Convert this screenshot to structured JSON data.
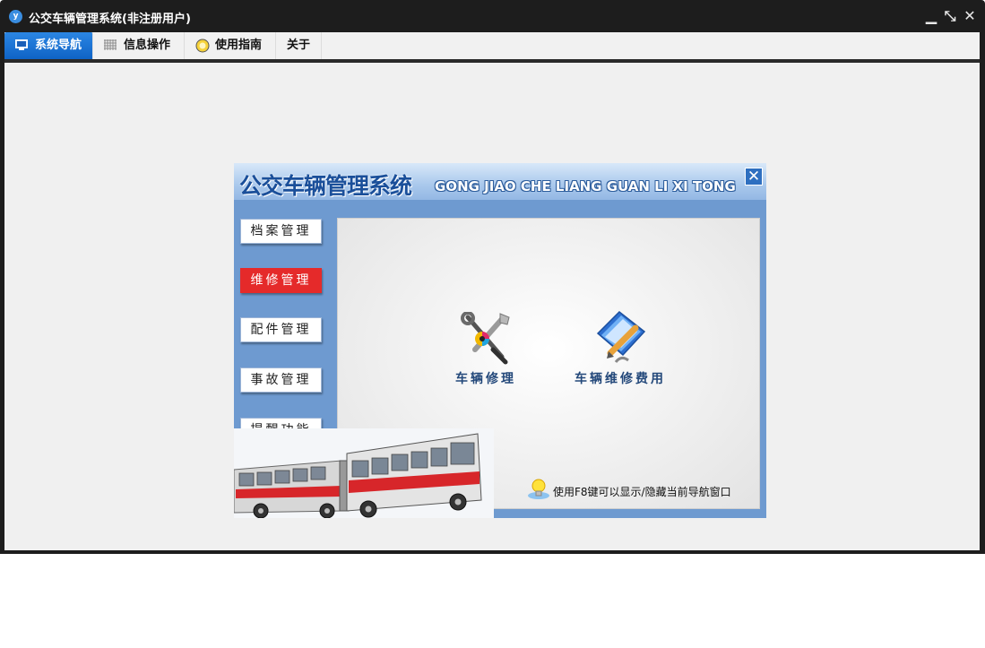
{
  "window": {
    "app_icon_text": "y",
    "title": "公交车辆管理系统(非注册用户)",
    "controls": {
      "minimize": "▁",
      "restore": "⤡",
      "close": "✕"
    }
  },
  "menu": {
    "tabs": [
      {
        "label": "系统导航",
        "icon": "monitor-icon",
        "active": true
      },
      {
        "label": "信息操作",
        "icon": "grid-icon",
        "active": false
      },
      {
        "label": "使用指南",
        "icon": "help-icon",
        "active": false
      },
      {
        "label": "关于",
        "icon": "",
        "active": false
      }
    ]
  },
  "panel": {
    "title": "公交车辆管理系统",
    "subtitle": "GONG JIAO CHE LIANG GUAN LI XI TONG",
    "close": "✕",
    "sidebar": [
      {
        "label": "档案管理",
        "active": false
      },
      {
        "label": "维修管理",
        "active": true
      },
      {
        "label": "配件管理",
        "active": false
      },
      {
        "label": "事故管理",
        "active": false
      },
      {
        "label": "提醒功能",
        "active": false
      }
    ],
    "features": [
      {
        "label": "车辆修理",
        "icon": "wrench-screwdriver-icon"
      },
      {
        "label": "车辆维修费用",
        "icon": "document-pencil-icon"
      }
    ],
    "hint": "使用F8键可以显示/隐藏当前导航窗口"
  },
  "colors": {
    "accent": "#0f63c6",
    "active_side": "#e52a2a",
    "title_blue": "#1a4f9a",
    "panel_blue": "#6e9ad0"
  }
}
